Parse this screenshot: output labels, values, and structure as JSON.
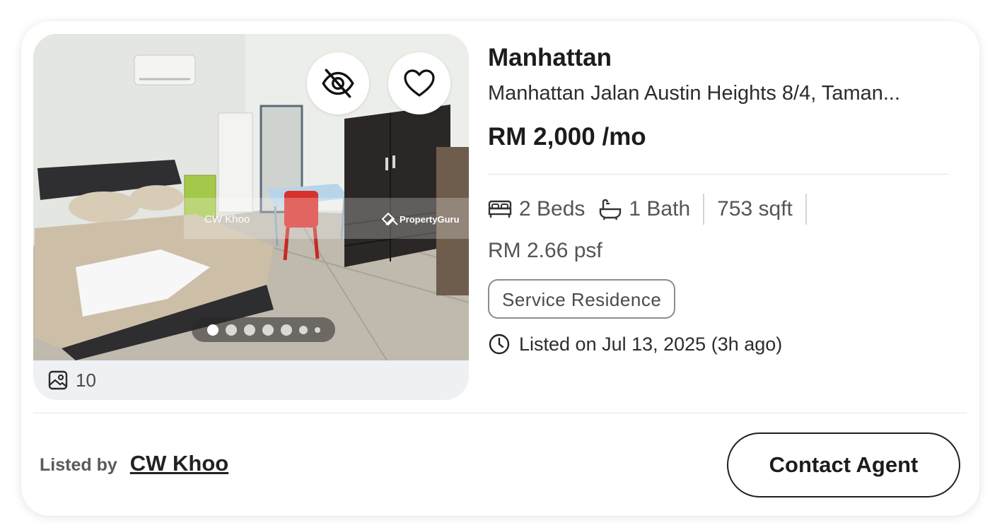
{
  "listing": {
    "title": "Manhattan",
    "address": "Manhattan Jalan Austin Heights 8/4, Taman...",
    "price": "RM 2,000 /mo",
    "beds": "2 Beds",
    "baths": "1 Bath",
    "area": "753 sqft",
    "psf": "RM 2.66 psf",
    "property_type": "Service Residence",
    "listed_on": "Listed on Jul 13, 2025 (3h ago)"
  },
  "gallery": {
    "photo_count": "10",
    "watermark_name": "CW Khoo",
    "watermark_brand": "PropertyGuru",
    "current_slide": 1,
    "visible_dots": 7
  },
  "agent": {
    "label": "Listed by",
    "name": "CW Khoo"
  },
  "actions": {
    "contact_label": "Contact Agent"
  },
  "icons": {
    "hide": "eye-off-icon",
    "favorite": "heart-icon",
    "photos": "image-icon",
    "bed": "bed-icon",
    "bath": "bathtub-icon",
    "time": "clock-icon"
  }
}
